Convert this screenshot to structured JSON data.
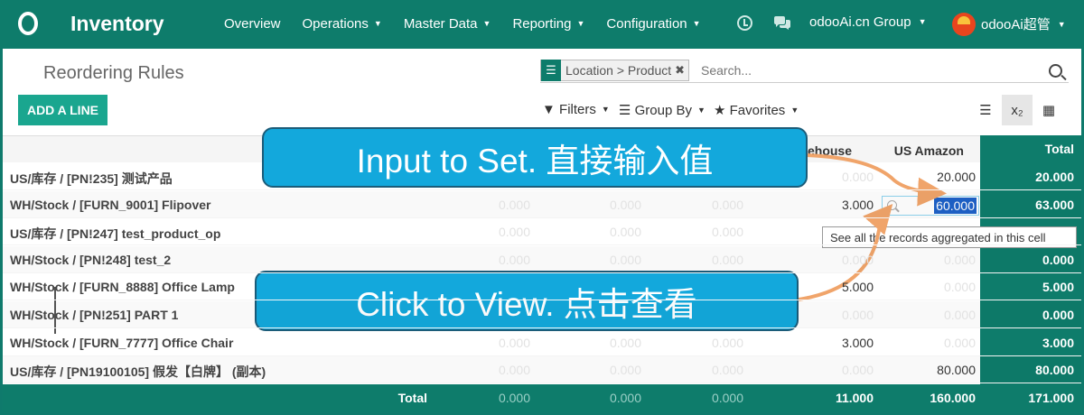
{
  "app": {
    "name": "Inventory",
    "menus": [
      "Overview",
      "Operations",
      "Master Data",
      "Reporting",
      "Configuration"
    ],
    "company": "odooAi.cn Group",
    "user": "odooAi超管"
  },
  "control": {
    "breadcrumb": "Reordering Rules",
    "facet": "Location > Product",
    "search_placeholder": "Search...",
    "add_button": "ADD A LINE",
    "filters": "Filters",
    "group_by": "Group By",
    "favorites": "Favorites",
    "view_pivot_label": "x₂"
  },
  "pivot": {
    "headers": {
      "warehouse": "ehouse",
      "amazon": "US Amazon",
      "total": "Total"
    },
    "rows": [
      {
        "label": "US/库存 / [PN!235] 测试产品",
        "c1": "",
        "c2": "",
        "c3": "",
        "wh": "0.000",
        "amz": "20.000",
        "total": "20.000"
      },
      {
        "label": "WH/Stock / [FURN_9001] Flipover",
        "c1": "0.000",
        "c2": "0.000",
        "c3": "0.000",
        "wh": "3.000",
        "amz": "60.000",
        "total": "63.000"
      },
      {
        "label": "US/库存 / [PN!247] test_product_op",
        "c1": "0.000",
        "c2": "0.000",
        "c3": "0.000",
        "wh": "",
        "amz": "",
        "total": ""
      },
      {
        "label": "WH/Stock / [PN!248] test_2",
        "c1": "0.000",
        "c2": "0.000",
        "c3": "0.000",
        "wh": "0.000",
        "amz": "0.000",
        "total": "0.000"
      },
      {
        "label": "WH/Stock / [FURN_8888] Office Lamp",
        "c1": "",
        "c2": "",
        "c3": "",
        "wh": "5.000",
        "amz": "0.000",
        "total": "5.000"
      },
      {
        "label": "WH/Stock / [PN!251] PART 1",
        "c1": "",
        "c2": "",
        "c3": "",
        "wh": "0.000",
        "amz": "0.000",
        "total": "0.000"
      },
      {
        "label": "WH/Stock / [FURN_7777] Office Chair",
        "c1": "0.000",
        "c2": "0.000",
        "c3": "0.000",
        "wh": "3.000",
        "amz": "0.000",
        "total": "3.000"
      },
      {
        "label": "US/库存 / [PN19100105] 假发【白牌】 (副本)",
        "c1": "0.000",
        "c2": "0.000",
        "c3": "0.000",
        "wh": "0.000",
        "amz": "80.000",
        "total": "80.000"
      }
    ],
    "footer": {
      "label": "Total",
      "c1": "0.000",
      "c2": "0.000",
      "c3": "0.000",
      "wh": "11.000",
      "amz": "160.000",
      "total": "171.000"
    },
    "editing_value": "60.000",
    "tooltip": "See all the records aggregated in this cell"
  },
  "callouts": {
    "set": "Input to Set.  直接输入值",
    "view": "Click to View.  点击查看"
  },
  "colors": {
    "brand": "#0e7c6b",
    "accent": "#1aa68f",
    "callout": "#13a8dc",
    "arrow": "#f0a46a"
  }
}
